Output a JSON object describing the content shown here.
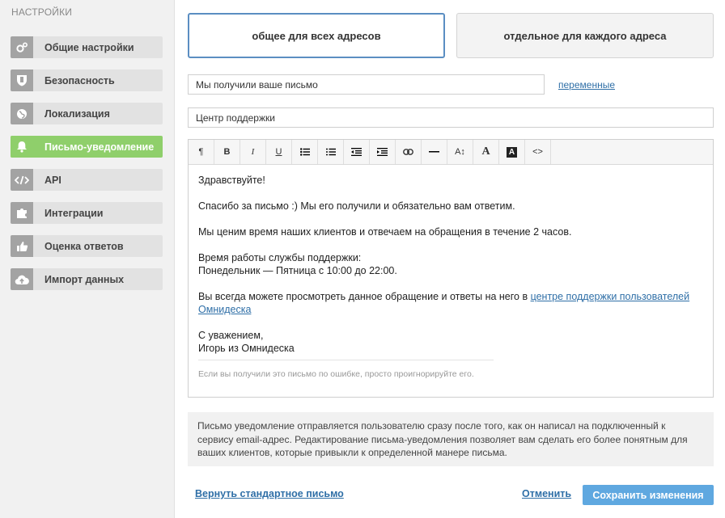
{
  "sidebar": {
    "title": "НАСТРОЙКИ",
    "items": [
      {
        "label": "Общие настройки",
        "icon": "gears-icon"
      },
      {
        "label": "Безопасность",
        "icon": "shield-icon"
      },
      {
        "label": "Локализация",
        "icon": "globe-icon"
      },
      {
        "label": "Письмо-уведомление",
        "icon": "bell-icon",
        "active": true
      },
      {
        "label": "API",
        "icon": "code-icon"
      },
      {
        "label": "Интеграции",
        "icon": "puzzle-icon"
      },
      {
        "label": "Оценка ответов",
        "icon": "thumbs-up-icon"
      },
      {
        "label": "Импорт данных",
        "icon": "cloud-upload-icon"
      }
    ]
  },
  "mode": {
    "common_label": "общее для всех адресов",
    "separate_label": "отдельное для каждого адреса",
    "selected": "common"
  },
  "subject": {
    "value": "Мы получили ваше письмо"
  },
  "variables_link": "переменные",
  "sender": {
    "value": "Центр поддержки"
  },
  "toolbar": {
    "buttons": [
      "paragraph-icon",
      "bold-icon",
      "italic-icon",
      "underline-icon",
      "bullet-list-icon",
      "numbered-list-icon",
      "outdent-icon",
      "indent-icon",
      "link-icon",
      "horizontal-rule-icon",
      "font-size-icon",
      "font-color-icon",
      "background-color-icon",
      "source-code-icon"
    ],
    "paragraph": "¶",
    "bold": "B",
    "italic": "I",
    "underline": "U",
    "font_size": "A↕",
    "font_color": "A",
    "bg_color": "A",
    "source": "<>"
  },
  "editor": {
    "greeting": "Здравствуйте!",
    "thanks": "Спасибо за письмо :) Мы его получили и обязательно вам ответим.",
    "response_time": "Мы ценим время наших клиентов и отвечаем на обращения в течение 2 часов.",
    "hours_title": "Время работы службы поддержки:",
    "hours_value": "Понедельник — Пятница с 10:00 до 22:00.",
    "view_prefix": "Вы всегда можете просмотреть данное обращение и ответы на него в ",
    "view_link": "центре поддержки пользователей Омнидеска",
    "regards": "С уважением,",
    "signature": "Игорь из Омнидеска",
    "footer": "Если вы получили это письмо по ошибке, просто проигнорируйте его."
  },
  "info_text": "Письмо уведомление отправляется пользователю сразу после того, как он написал на подключенный к сервису email-адрес. Редактирование письма-уведомления позволяет вам сделать его более понятным для ваших клиентов, которые привыкли к определенной манере письма.",
  "actions": {
    "restore": "Вернуть стандартное письмо",
    "cancel": "Отменить",
    "save": "Сохранить изменения"
  },
  "colors": {
    "accent": "#5fa8e0",
    "active_nav": "#8fcf6b",
    "link": "#2f6fa7",
    "selected_border": "#5b8ec2"
  }
}
